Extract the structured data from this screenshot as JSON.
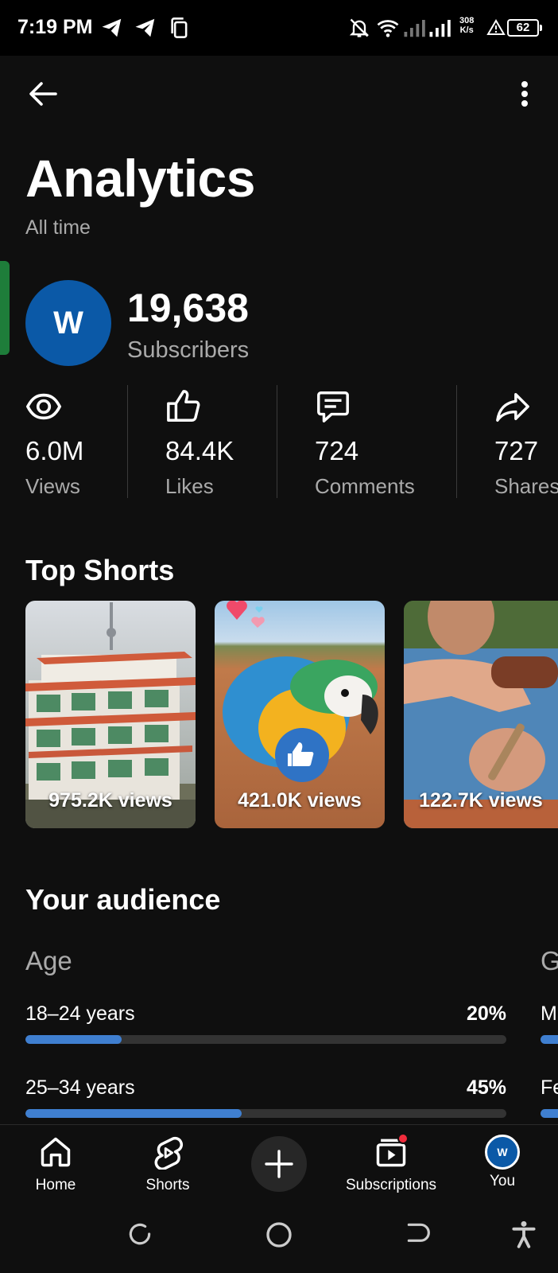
{
  "status_bar": {
    "time": "7:19 PM",
    "net_speed_value": "308",
    "net_speed_unit": "K/s",
    "battery": "62",
    "icons": [
      "telegram-icon",
      "telegram-icon",
      "copy-icon",
      "bell-off-icon",
      "wifi-icon",
      "signal-icon",
      "signal-icon",
      "warning-icon",
      "battery-icon"
    ]
  },
  "header": {
    "title": "Analytics",
    "subtitle": "All time"
  },
  "channel": {
    "avatar_letter": "W",
    "subscriber_count": "19,638",
    "subscriber_label": "Subscribers"
  },
  "stats": [
    {
      "icon": "eye-icon",
      "value": "6.0M",
      "label": "Views"
    },
    {
      "icon": "thumbs-up-icon",
      "value": "84.4K",
      "label": "Likes"
    },
    {
      "icon": "comment-icon",
      "value": "724",
      "label": "Comments"
    },
    {
      "icon": "share-icon",
      "value": "727",
      "label": "Shares"
    }
  ],
  "top_shorts": {
    "title": "Top Shorts",
    "items": [
      {
        "views": "975.2K views"
      },
      {
        "views": "421.0K views"
      },
      {
        "views": "122.7K views"
      }
    ]
  },
  "audience": {
    "title": "Your audience",
    "age": {
      "title": "Age",
      "rows": [
        {
          "label": "18–24 years",
          "pct": "20%",
          "fraction": 0.2
        },
        {
          "label": "25–34 years",
          "pct": "45%",
          "fraction": 0.45
        }
      ]
    },
    "second_column": {
      "title": "G",
      "rows": [
        {
          "label": "M"
        },
        {
          "label": "Fe"
        }
      ]
    }
  },
  "bottom_nav": {
    "items": [
      {
        "label": "Home",
        "icon": "home-icon"
      },
      {
        "label": "Shorts",
        "icon": "shorts-icon"
      },
      {
        "label": "",
        "icon": "plus-icon"
      },
      {
        "label": "Subscriptions",
        "icon": "subscriptions-icon"
      },
      {
        "label": "You",
        "icon": "avatar"
      }
    ],
    "you_avatar_letter": "W"
  },
  "colors": {
    "background": "#0f0f0f",
    "accent_bar": "#3f7fd0",
    "avatar": "#0b59a7",
    "notification_dot": "#f02c3c"
  }
}
